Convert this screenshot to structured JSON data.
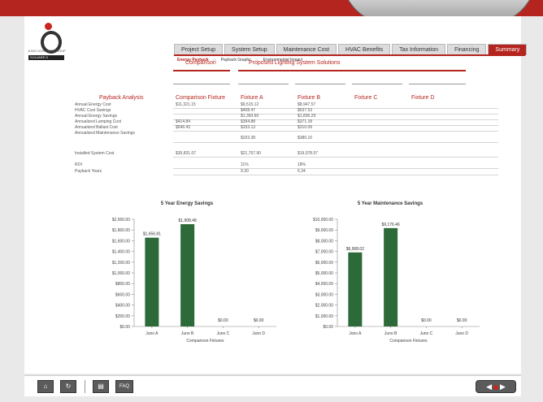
{
  "company": "JUNO LIGHTING GROUP",
  "badge_label": "SOLVARE D",
  "tabs": [
    {
      "label": "Project Setup"
    },
    {
      "label": "System Setup"
    },
    {
      "label": "Maintenance Cost"
    },
    {
      "label": "HVAC Benefits"
    },
    {
      "label": "Tax Information"
    },
    {
      "label": "Financing"
    },
    {
      "label": "Summary"
    }
  ],
  "subnav": [
    "Energy Payback",
    "Payback Graphs",
    "Environmental Impact"
  ],
  "groups": {
    "comparison": "Comparison",
    "proposed": "Proposed Lighting System Solutions"
  },
  "columns": [
    "Payback Analysis",
    "Comparison Fixture",
    "Fixture A",
    "Fixture B",
    "Fixture C",
    "Fixture D"
  ],
  "rows": [
    {
      "label": "Annual Energy Cost",
      "values": [
        "$11,321.15",
        "$9,515.12",
        "$8,947.57",
        "",
        ""
      ]
    },
    {
      "label": "HVAC Cost Savings",
      "values": [
        "",
        "$408.47",
        "$537.53",
        "",
        ""
      ]
    },
    {
      "label": "Annual Energy Savings",
      "values": [
        "",
        "$1,393.60",
        "$1,836.29",
        "",
        ""
      ]
    },
    {
      "label": "Annualized Lamping Cost",
      "values": [
        "$414.84",
        "$394.88",
        "$371.18",
        "",
        ""
      ]
    },
    {
      "label": "Annualized Ballast Cost",
      "values": [
        "$646.43",
        "$333.13",
        "$310.09",
        "",
        ""
      ]
    },
    {
      "label": "Annualized Maintenance Savings",
      "values": [
        "",
        "$333.38",
        "$380.10",
        "",
        ""
      ]
    },
    {
      "label": "Installed System Cost",
      "values": [
        "$35,831.07",
        "$21,757.90",
        "$19,078.57",
        "",
        ""
      ]
    },
    {
      "label": "ROI",
      "values": [
        "",
        "11%",
        "18%",
        "",
        ""
      ]
    },
    {
      "label": "Payback Years",
      "values": [
        "",
        "9.30",
        "6.34",
        "",
        ""
      ]
    }
  ],
  "chart_data": [
    {
      "type": "bar",
      "title": "5 Year Energy Savings",
      "xlabel": "Comparison Fixtures",
      "ylabel": "",
      "categories": [
        "Juno A",
        "Juno B",
        "Juno C",
        "Juno D"
      ],
      "values": [
        1656.81,
        1908.48,
        0,
        0
      ],
      "data_labels": [
        "$1,656.81",
        "$1,908.48",
        "$0.00",
        "$0.00"
      ],
      "ylim": [
        0,
        2000
      ],
      "yticks": [
        "$0.00",
        "$200.00",
        "$400.00",
        "$600.00",
        "$800.00",
        "$1,000.00",
        "$1,200.00",
        "$1,400.00",
        "$1,600.00",
        "$1,800.00",
        "$2,000.00"
      ],
      "color": "#2d6a3a",
      "grid": false
    },
    {
      "type": "bar",
      "title": "5 Year Maintenance Savings",
      "xlabel": "Comparison Fixtures",
      "ylabel": "",
      "categories": [
        "Juno A",
        "Juno B",
        "Juno C",
        "Juno D"
      ],
      "values": [
        6908.02,
        9176.46,
        0,
        0
      ],
      "data_labels": [
        "$6,908.02",
        "$9,176.46",
        "$0.00",
        "$0.00"
      ],
      "ylim": [
        0,
        10000
      ],
      "yticks": [
        "$0.00",
        "$1,000.00",
        "$2,000.00",
        "$3,000.00",
        "$4,000.00",
        "$5,000.00",
        "$6,000.00",
        "$7,000.00",
        "$8,000.00",
        "$9,000.00",
        "$10,000.00"
      ],
      "color": "#2d6a3a",
      "grid": false
    }
  ],
  "footer": {
    "faq_label": "FAQ"
  },
  "colors": {
    "accent": "#b5251f",
    "bar": "#2d6a3a"
  }
}
